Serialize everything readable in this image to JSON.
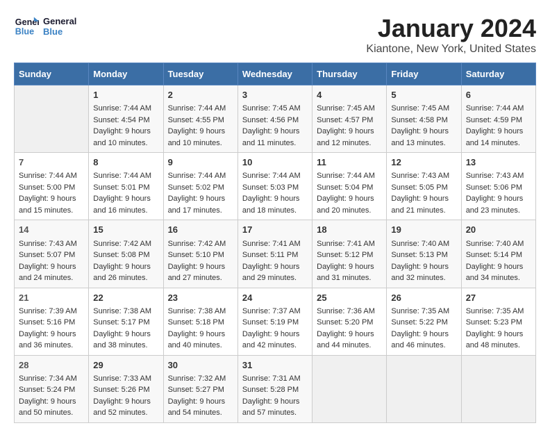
{
  "logo": {
    "line1": "General",
    "line2": "Blue"
  },
  "title": "January 2024",
  "subtitle": "Kiantone, New York, United States",
  "headers": [
    "Sunday",
    "Monday",
    "Tuesday",
    "Wednesday",
    "Thursday",
    "Friday",
    "Saturday"
  ],
  "weeks": [
    [
      {
        "day": "",
        "info": ""
      },
      {
        "day": "1",
        "info": "Sunrise: 7:44 AM\nSunset: 4:54 PM\nDaylight: 9 hours\nand 10 minutes."
      },
      {
        "day": "2",
        "info": "Sunrise: 7:44 AM\nSunset: 4:55 PM\nDaylight: 9 hours\nand 10 minutes."
      },
      {
        "day": "3",
        "info": "Sunrise: 7:45 AM\nSunset: 4:56 PM\nDaylight: 9 hours\nand 11 minutes."
      },
      {
        "day": "4",
        "info": "Sunrise: 7:45 AM\nSunset: 4:57 PM\nDaylight: 9 hours\nand 12 minutes."
      },
      {
        "day": "5",
        "info": "Sunrise: 7:45 AM\nSunset: 4:58 PM\nDaylight: 9 hours\nand 13 minutes."
      },
      {
        "day": "6",
        "info": "Sunrise: 7:44 AM\nSunset: 4:59 PM\nDaylight: 9 hours\nand 14 minutes."
      }
    ],
    [
      {
        "day": "7",
        "info": "Sunrise: 7:44 AM\nSunset: 5:00 PM\nDaylight: 9 hours\nand 15 minutes."
      },
      {
        "day": "8",
        "info": "Sunrise: 7:44 AM\nSunset: 5:01 PM\nDaylight: 9 hours\nand 16 minutes."
      },
      {
        "day": "9",
        "info": "Sunrise: 7:44 AM\nSunset: 5:02 PM\nDaylight: 9 hours\nand 17 minutes."
      },
      {
        "day": "10",
        "info": "Sunrise: 7:44 AM\nSunset: 5:03 PM\nDaylight: 9 hours\nand 18 minutes."
      },
      {
        "day": "11",
        "info": "Sunrise: 7:44 AM\nSunset: 5:04 PM\nDaylight: 9 hours\nand 20 minutes."
      },
      {
        "day": "12",
        "info": "Sunrise: 7:43 AM\nSunset: 5:05 PM\nDaylight: 9 hours\nand 21 minutes."
      },
      {
        "day": "13",
        "info": "Sunrise: 7:43 AM\nSunset: 5:06 PM\nDaylight: 9 hours\nand 23 minutes."
      }
    ],
    [
      {
        "day": "14",
        "info": "Sunrise: 7:43 AM\nSunset: 5:07 PM\nDaylight: 9 hours\nand 24 minutes."
      },
      {
        "day": "15",
        "info": "Sunrise: 7:42 AM\nSunset: 5:08 PM\nDaylight: 9 hours\nand 26 minutes."
      },
      {
        "day": "16",
        "info": "Sunrise: 7:42 AM\nSunset: 5:10 PM\nDaylight: 9 hours\nand 27 minutes."
      },
      {
        "day": "17",
        "info": "Sunrise: 7:41 AM\nSunset: 5:11 PM\nDaylight: 9 hours\nand 29 minutes."
      },
      {
        "day": "18",
        "info": "Sunrise: 7:41 AM\nSunset: 5:12 PM\nDaylight: 9 hours\nand 31 minutes."
      },
      {
        "day": "19",
        "info": "Sunrise: 7:40 AM\nSunset: 5:13 PM\nDaylight: 9 hours\nand 32 minutes."
      },
      {
        "day": "20",
        "info": "Sunrise: 7:40 AM\nSunset: 5:14 PM\nDaylight: 9 hours\nand 34 minutes."
      }
    ],
    [
      {
        "day": "21",
        "info": "Sunrise: 7:39 AM\nSunset: 5:16 PM\nDaylight: 9 hours\nand 36 minutes."
      },
      {
        "day": "22",
        "info": "Sunrise: 7:38 AM\nSunset: 5:17 PM\nDaylight: 9 hours\nand 38 minutes."
      },
      {
        "day": "23",
        "info": "Sunrise: 7:38 AM\nSunset: 5:18 PM\nDaylight: 9 hours\nand 40 minutes."
      },
      {
        "day": "24",
        "info": "Sunrise: 7:37 AM\nSunset: 5:19 PM\nDaylight: 9 hours\nand 42 minutes."
      },
      {
        "day": "25",
        "info": "Sunrise: 7:36 AM\nSunset: 5:20 PM\nDaylight: 9 hours\nand 44 minutes."
      },
      {
        "day": "26",
        "info": "Sunrise: 7:35 AM\nSunset: 5:22 PM\nDaylight: 9 hours\nand 46 minutes."
      },
      {
        "day": "27",
        "info": "Sunrise: 7:35 AM\nSunset: 5:23 PM\nDaylight: 9 hours\nand 48 minutes."
      }
    ],
    [
      {
        "day": "28",
        "info": "Sunrise: 7:34 AM\nSunset: 5:24 PM\nDaylight: 9 hours\nand 50 minutes."
      },
      {
        "day": "29",
        "info": "Sunrise: 7:33 AM\nSunset: 5:26 PM\nDaylight: 9 hours\nand 52 minutes."
      },
      {
        "day": "30",
        "info": "Sunrise: 7:32 AM\nSunset: 5:27 PM\nDaylight: 9 hours\nand 54 minutes."
      },
      {
        "day": "31",
        "info": "Sunrise: 7:31 AM\nSunset: 5:28 PM\nDaylight: 9 hours\nand 57 minutes."
      },
      {
        "day": "",
        "info": ""
      },
      {
        "day": "",
        "info": ""
      },
      {
        "day": "",
        "info": ""
      }
    ]
  ]
}
